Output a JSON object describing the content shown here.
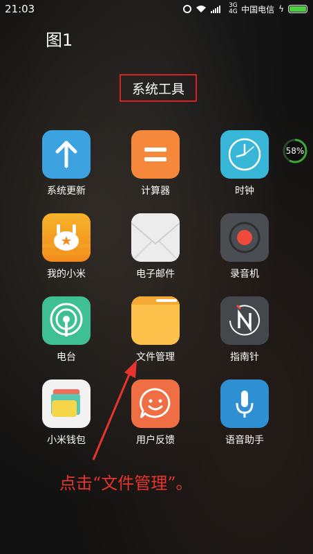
{
  "status_bar": {
    "time": "21:03",
    "carrier": "中国电信",
    "network_type": "3G 4G",
    "battery_icon": "battery-charging",
    "battery_color": "#4dd040"
  },
  "figure_label": "图1",
  "folder": {
    "title": "系统工具"
  },
  "memory_widget": {
    "percent_text": "58%",
    "percent": 58
  },
  "apps": [
    {
      "label": "系统更新",
      "icon": "upload-arrow-icon",
      "color": "#3ca2e0"
    },
    {
      "label": "计算器",
      "icon": "equals-icon",
      "color": "#f5883a"
    },
    {
      "label": "时钟",
      "icon": "clock-icon",
      "color": "#38b6d8"
    },
    {
      "label": "我的小米",
      "icon": "mi-bunny-icon",
      "color": "#f39a1e"
    },
    {
      "label": "电子邮件",
      "icon": "envelope-icon",
      "color": "#e9e9e9"
    },
    {
      "label": "录音机",
      "icon": "record-icon",
      "color": "#4a4d52"
    },
    {
      "label": "电台",
      "icon": "radio-icon",
      "color": "#3fbf94"
    },
    {
      "label": "文件管理",
      "icon": "folder-icon",
      "color": "#f9c04a"
    },
    {
      "label": "指南针",
      "icon": "compass-icon",
      "color": "#44484d"
    },
    {
      "label": "小米钱包",
      "icon": "wallet-icon",
      "color": "#f2f2f2"
    },
    {
      "label": "用户反馈",
      "icon": "smile-chat-icon",
      "color": "#ef6e44"
    },
    {
      "label": "语音助手",
      "icon": "microphone-icon",
      "color": "#2e8fd2"
    }
  ],
  "annotation": {
    "text": "点击“文件管理”。",
    "color": "#e8342c"
  }
}
